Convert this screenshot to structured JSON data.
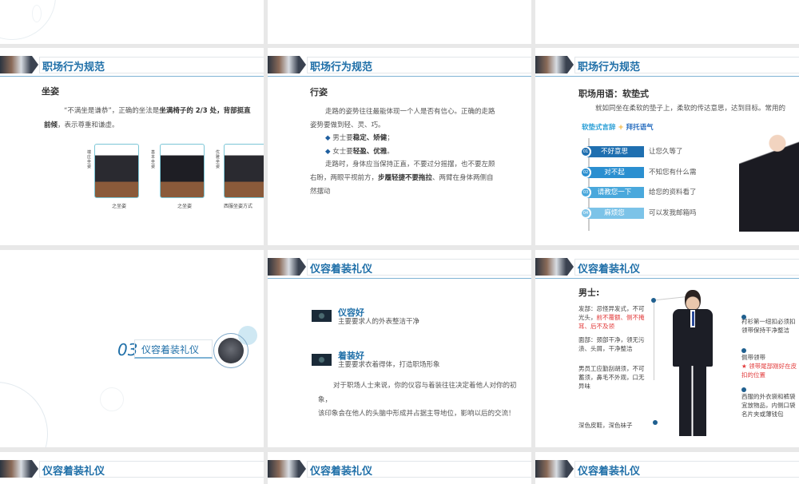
{
  "header_title_conduct": "职场行为规范",
  "header_title_appearance": "仪容着装礼仪",
  "sitting": {
    "heading": "坐姿",
    "line1_a": "“不满坐是谦恭”，正确的坐法是",
    "line1_b": "坐满椅子的 2/3 处，背部挺直",
    "line2_a": "前倾",
    "line2_b": "，表示尊重和谦虚。",
    "photo_labels": [
      "端庄坐姿",
      "基本坐姿",
      "优雅坐姿"
    ],
    "photo_captions": [
      "之坐姿",
      "之坐姿",
      "西服坐姿方式"
    ]
  },
  "walking": {
    "heading": "行姿",
    "p1_line1": "走路的姿势往往最能体现一个人是否有信心。正确的走路",
    "p1_line2": "姿势要做到轻、灵、巧。",
    "bullet1_a": "男士要",
    "bullet1_b": "稳定、矫健",
    "bullet1_c": "；",
    "bullet2_a": "女士要",
    "bullet2_b": "轻盈、优雅",
    "bullet2_c": "。",
    "p2_line1": "走路时，身体应当保持正直，不要过分摇摆，也不要左顾",
    "p2_line2_a": "右盼，两眼平视前方，",
    "p2_line2_b": "步履轻捷不要拖拉",
    "p2_line2_c": "、两臂在身体两侧自",
    "p2_line3": "然摆动"
  },
  "soft_speech": {
    "heading": "职场用语：软垫式",
    "intro": "就如同坐在柔软的垫子上，柔软的传达意思，达到目标。常用的",
    "formula_a": "软垫式言辞",
    "formula_plus": "+",
    "formula_b": "拜托语气",
    "items": [
      {
        "num": "01",
        "label": "不好意思",
        "example": "让您久等了",
        "color": "#1f6fb0"
      },
      {
        "num": "02",
        "label": "对不起",
        "example": "不知您有什么需",
        "color": "#2b8fd0"
      },
      {
        "num": "03",
        "label": "请教您一下",
        "example": "给您的资料看了",
        "color": "#4aa8dc"
      },
      {
        "num": "04",
        "label": "麻烦您",
        "example": "可以发我邮箱吗",
        "color": "#7cc3e8"
      }
    ]
  },
  "section": {
    "number": "03",
    "title": "仪容着装礼仪"
  },
  "appearance": {
    "item1_title": "仪容好",
    "item1_desc": "主要要求人的外表整洁干净",
    "item2_title": "着装好",
    "item2_desc": "主要要求衣着得体，打造职场形象",
    "para_line1": "对于职场人士来说，你的仪容与着装往往决定着他人对你的初",
    "para_line2": "象，",
    "para_line3": "该印象会在他人的头脑中形成并占据主导地位，影响以后的交流！"
  },
  "men": {
    "heading": "男士:",
    "hair_a": "发部：忌怪异发式，不可",
    "hair_b": "光头，",
    "hair_red1": "前不覆额、侧不掩",
    "hair_red2": "耳、后不及领",
    "face1": "面部：颈部干净，领无污",
    "face2": "渍、头屑，干净整洁",
    "beard1": "男员工应勤刮胡须，不可",
    "beard2": "蓄须，鼻毛不外观，口无",
    "beard3": "异味",
    "shoes": "深色皮鞋，深色袜子",
    "shirt1": "衬衫第一纽扣必须扣",
    "shirt2": "领带保持干净整洁",
    "tie1": "佩带领带",
    "tie_red1": "★ 领带尾部刚好在皮",
    "tie_red2": "扣的位置",
    "pocket1": "西服的外衣袋和裤袋",
    "pocket2": "宜放物品，内侧口袋",
    "pocket3": "名片夹或薄钱包"
  }
}
